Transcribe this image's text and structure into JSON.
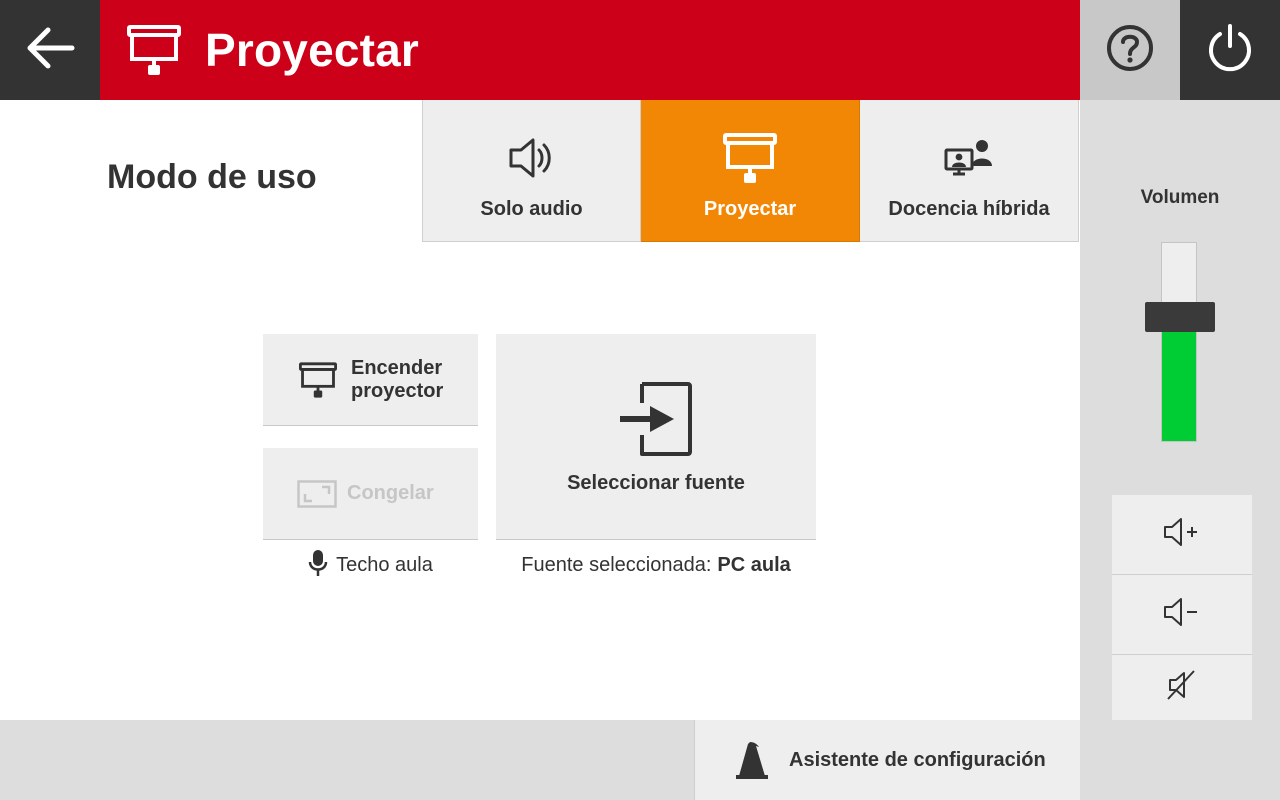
{
  "header": {
    "title": "Proyectar",
    "back_icon": "arrow-left-icon",
    "title_icon": "projector-screen-icon",
    "help_icon": "help-icon",
    "power_icon": "power-icon",
    "colors": {
      "bar": "#cc0018",
      "dark": "#333333",
      "help_bg": "#c8c8c8"
    }
  },
  "mode": {
    "label": "Modo de uso",
    "active_color": "#f28705",
    "tabs": [
      {
        "label": "Solo audio",
        "icon": "speaker-icon",
        "active": false
      },
      {
        "label": "Proyectar",
        "icon": "projector-screen-icon",
        "active": true
      },
      {
        "label": "Docencia híbrida",
        "icon": "hybrid-teaching-icon",
        "active": false
      }
    ]
  },
  "actions": {
    "projector_label_line1": "Encender",
    "projector_label_line2": "proyector",
    "freeze_label": "Congelar",
    "mic_label": "Techo aula",
    "source_label": "Seleccionar fuente",
    "source_prefix": "Fuente seleccionada:",
    "source_value": "PC aula"
  },
  "volume": {
    "title": "Volumen",
    "level": 0.6,
    "fill_color": "#00cc33",
    "buttons": [
      {
        "icon": "volume-up-icon"
      },
      {
        "icon": "volume-down-icon"
      },
      {
        "icon": "mute-icon"
      }
    ]
  },
  "footer": {
    "assistant_label": "Asistente de configuración",
    "assistant_icon": "cone-icon"
  }
}
